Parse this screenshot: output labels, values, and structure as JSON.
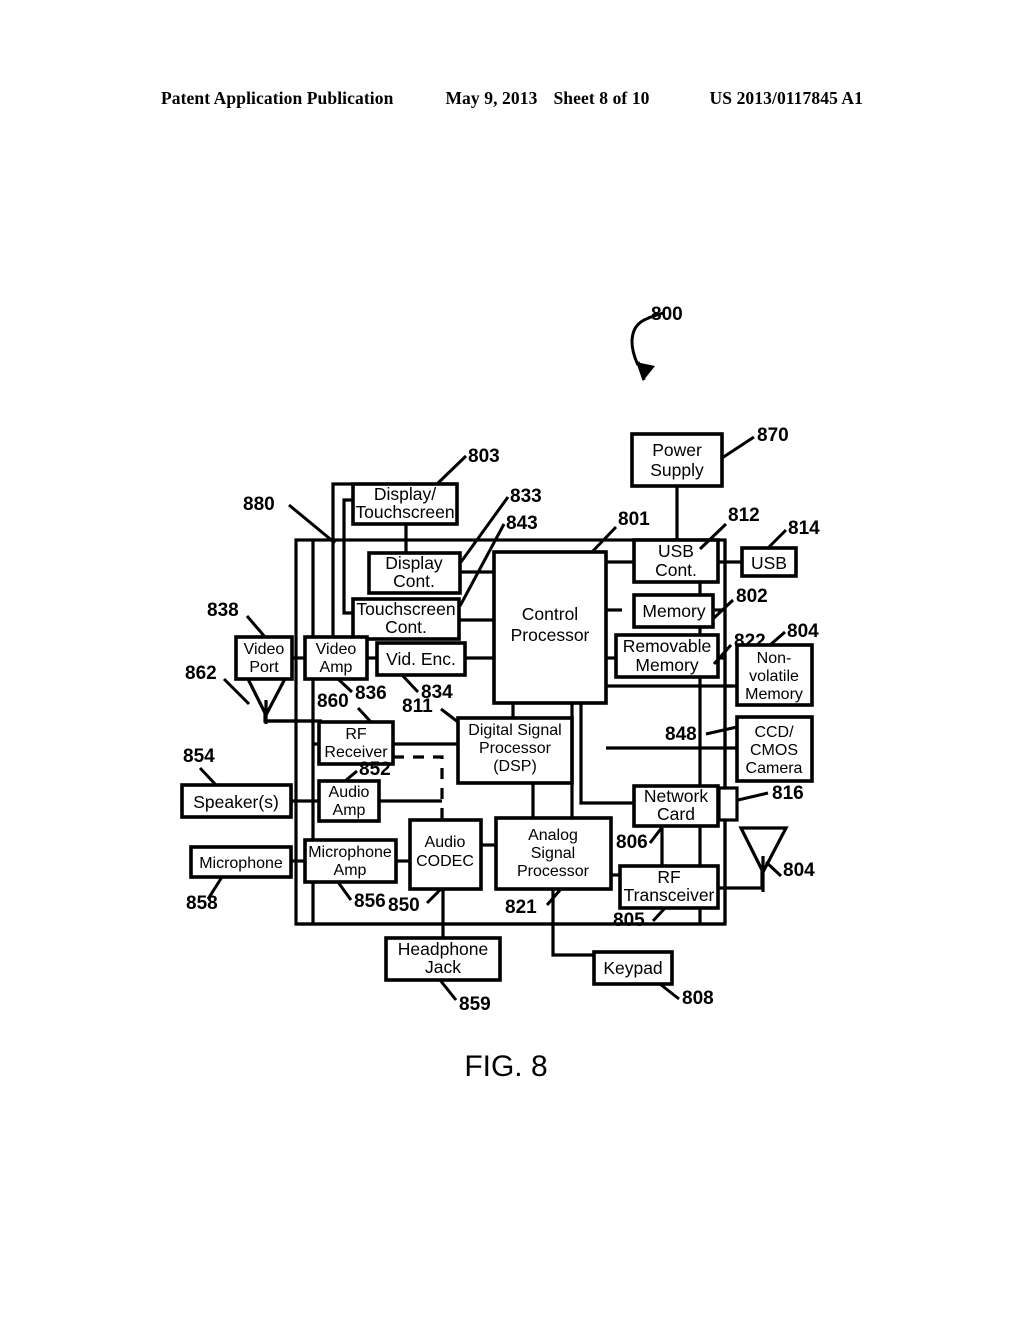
{
  "header": {
    "publication": "Patent Application Publication",
    "date": "May 9, 2013",
    "sheet": "Sheet 8 of 10",
    "patent_number": "US 2013/0117845 A1"
  },
  "figure": {
    "caption": "FIG. 8",
    "system_ref": "800"
  },
  "blocks": [
    {
      "id": "display_touchscreen",
      "lines": [
        "Display/",
        "Touchscreen"
      ],
      "ref": "803"
    },
    {
      "id": "display_cont",
      "lines": [
        "Display",
        "Cont."
      ],
      "ref": "833"
    },
    {
      "id": "touchscreen_cont",
      "lines": [
        "Touchscreen",
        "Cont."
      ],
      "ref": "843"
    },
    {
      "id": "control_processor",
      "lines": [
        "Control",
        "Processor"
      ],
      "ref": "801"
    },
    {
      "id": "power_supply",
      "lines": [
        "Power",
        "Supply"
      ],
      "ref": "870"
    },
    {
      "id": "usb_cont",
      "lines": [
        "USB",
        "Cont."
      ],
      "ref": "812"
    },
    {
      "id": "usb",
      "lines": [
        "USB"
      ],
      "ref": "814"
    },
    {
      "id": "memory",
      "lines": [
        "Memory"
      ],
      "ref": "802"
    },
    {
      "id": "removable_memory",
      "lines": [
        "Removable",
        "Memory"
      ],
      "ref": "822"
    },
    {
      "id": "nonvolatile_memory",
      "lines": [
        "Non-",
        "volatile",
        "Memory"
      ],
      "ref": "804"
    },
    {
      "id": "ccd_cmos_camera",
      "lines": [
        "CCD/",
        "CMOS",
        "Camera"
      ],
      "ref": "848"
    },
    {
      "id": "network_card",
      "lines": [
        "Network",
        "Card"
      ],
      "ref": "806"
    },
    {
      "id": "rf_transceiver",
      "lines": [
        "RF",
        "Transceiver"
      ],
      "ref": "805"
    },
    {
      "id": "video_port",
      "lines": [
        "Video",
        "Port"
      ],
      "ref": "838"
    },
    {
      "id": "video_amp",
      "lines": [
        "Video",
        "Amp"
      ],
      "ref": "836"
    },
    {
      "id": "vid_enc",
      "lines": [
        "Vid. Enc."
      ],
      "ref": "834"
    },
    {
      "id": "rf_receiver",
      "lines": [
        "RF",
        "Receiver"
      ],
      "ref": "860"
    },
    {
      "id": "dsp",
      "lines": [
        "Digital Signal",
        "Processor",
        "(DSP)"
      ],
      "ref": "811"
    },
    {
      "id": "speakers",
      "lines": [
        "Speaker(s)"
      ],
      "ref": "854"
    },
    {
      "id": "audio_amp",
      "lines": [
        "Audio",
        "Amp"
      ],
      "ref": "852"
    },
    {
      "id": "microphone",
      "lines": [
        "Microphone"
      ],
      "ref": "858"
    },
    {
      "id": "microphone_amp",
      "lines": [
        "Microphone",
        "Amp"
      ],
      "ref": "856"
    },
    {
      "id": "audio_codec",
      "lines": [
        "Audio",
        "CODEC"
      ],
      "ref": "850"
    },
    {
      "id": "analog_signal_processor",
      "lines": [
        "Analog",
        "Signal",
        "Processor"
      ],
      "ref": "821"
    },
    {
      "id": "headphone_jack",
      "lines": [
        "Headphone",
        "Jack"
      ],
      "ref": "859"
    },
    {
      "id": "keypad",
      "lines": [
        "Keypad"
      ],
      "ref": "808"
    }
  ],
  "refs": {
    "enclosure": "880",
    "video_antenna": "862",
    "rf_antenna": "804",
    "network_connector": "816",
    "system": "800"
  },
  "icons": {
    "antenna": "antenna-icon",
    "connector": "network-connector-icon",
    "arrow": "system-pointer-arrow-icon"
  },
  "colors": {
    "line": "#000000",
    "background": "#ffffff"
  }
}
